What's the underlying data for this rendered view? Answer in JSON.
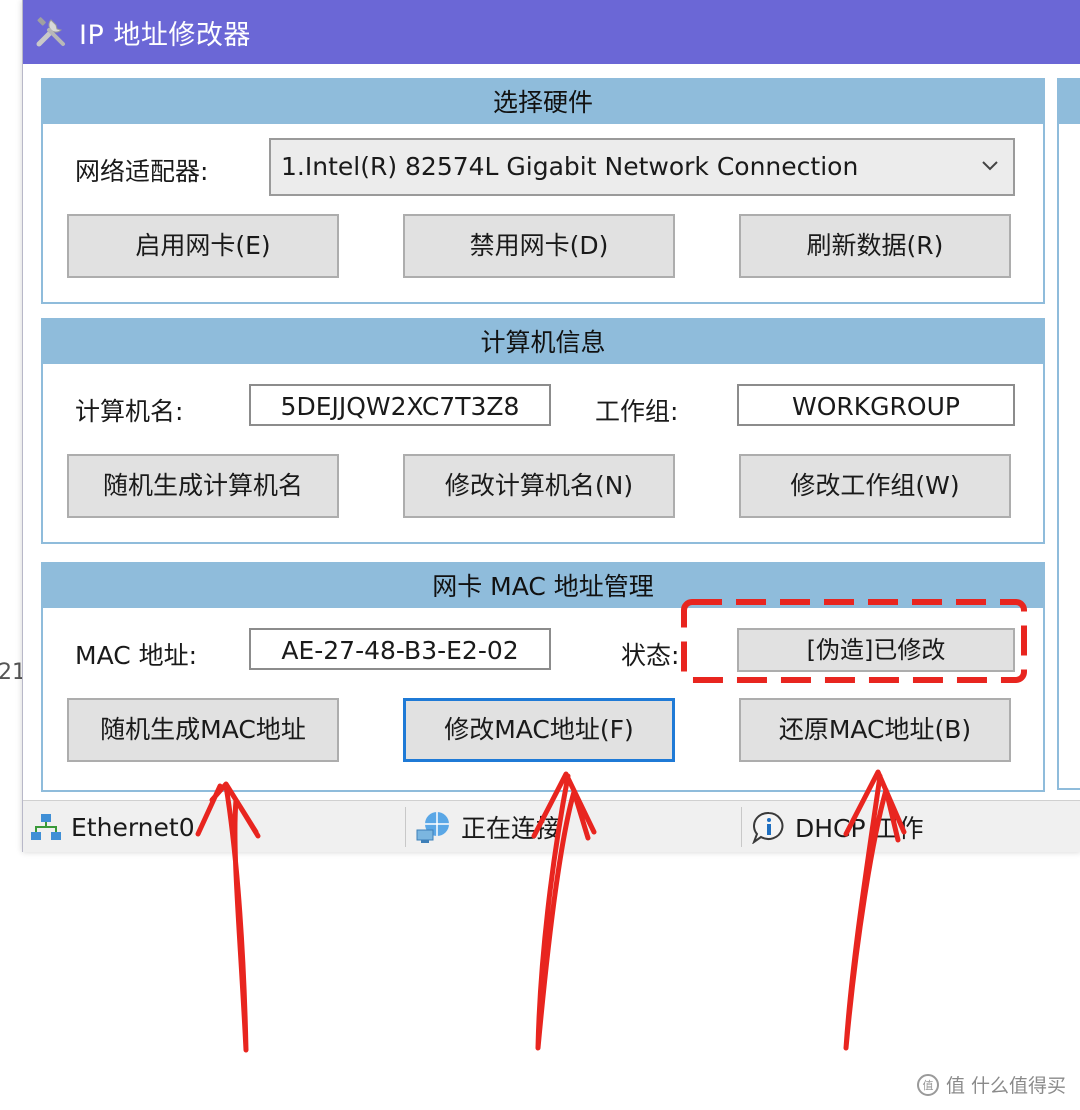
{
  "window": {
    "title": "IP 地址修改器",
    "accent_color": "#6b67d6",
    "panel_header_color": "#8fbcdb"
  },
  "hardware": {
    "header": "选择硬件",
    "adapter_label": "网络适配器:",
    "adapter_selected": "1.Intel(R) 82574L Gigabit Network Connection",
    "buttons": {
      "enable": "启用网卡(E)",
      "disable": "禁用网卡(D)",
      "refresh": "刷新数据(R)"
    }
  },
  "computer": {
    "header": "计算机信息",
    "name_label": "计算机名:",
    "name_value": "5DEJJQW2XC7T3Z8",
    "workgroup_label": "工作组:",
    "workgroup_value": "WORKGROUP",
    "buttons": {
      "random_name": "随机生成计算机名",
      "modify_name": "修改计算机名(N)",
      "modify_workgroup": "修改工作组(W)"
    }
  },
  "mac": {
    "header": "网卡 MAC 地址管理",
    "address_label": "MAC 地址:",
    "address_value": "AE-27-48-B3-E2-02",
    "status_label": "状态:",
    "status_value": "[伪造]已修改",
    "buttons": {
      "random_mac": "随机生成MAC地址",
      "modify_mac": "修改MAC地址(F)",
      "restore_mac": "还原MAC地址(B)"
    }
  },
  "statusbar": {
    "network": "Ethernet0",
    "connection": "正在连接",
    "dhcp": "DHCP 工作"
  },
  "outside_fragment": "21",
  "annotation_color": "#e8251f",
  "watermark": "值 什么值得买"
}
